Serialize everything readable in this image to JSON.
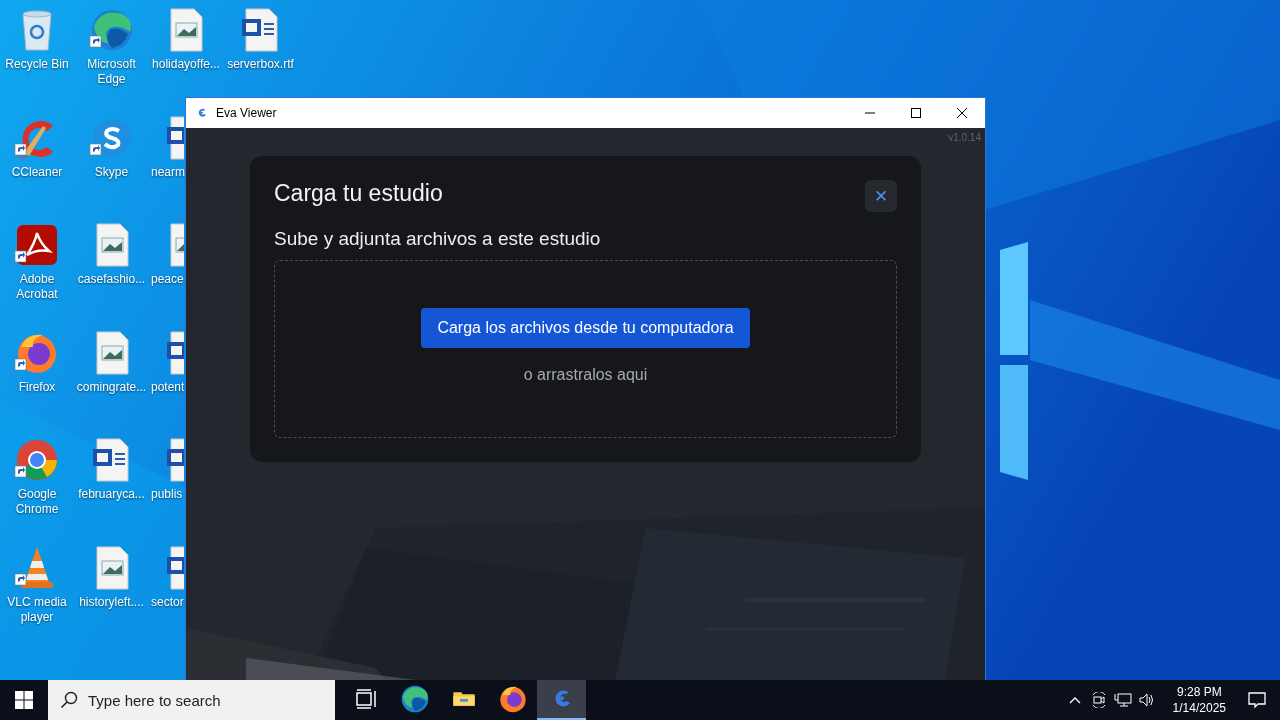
{
  "desktop": {
    "columns": [
      [
        {
          "label": "Recycle Bin",
          "kind": "recycle-bin",
          "shortcut": false
        },
        {
          "label": "CCleaner",
          "kind": "ccleaner",
          "shortcut": true
        },
        {
          "label": "Adobe Acrobat",
          "kind": "acrobat",
          "shortcut": true
        },
        {
          "label": "Firefox",
          "kind": "firefox",
          "shortcut": true
        },
        {
          "label": "Google Chrome",
          "kind": "chrome",
          "shortcut": true
        },
        {
          "label": "VLC media player",
          "kind": "vlc",
          "shortcut": true
        }
      ],
      [
        {
          "label": "Microsoft Edge",
          "kind": "edge",
          "shortcut": true
        },
        {
          "label": "Skype",
          "kind": "skype",
          "shortcut": true
        },
        {
          "label": "casefashio...",
          "kind": "image-file",
          "shortcut": false
        },
        {
          "label": "comingrate...",
          "kind": "image-file",
          "shortcut": false
        },
        {
          "label": "februaryca...",
          "kind": "word-file",
          "shortcut": false
        },
        {
          "label": "historyleft....",
          "kind": "image-file",
          "shortcut": false
        }
      ],
      [
        {
          "label": "holidayoffe...",
          "kind": "image-file",
          "shortcut": false
        },
        {
          "label": "nearm",
          "kind": "word-file",
          "shortcut": false
        },
        {
          "label": "peace",
          "kind": "image-file",
          "shortcut": false
        },
        {
          "label": "potent",
          "kind": "word-file",
          "shortcut": false
        },
        {
          "label": "publis",
          "kind": "word-file",
          "shortcut": false
        },
        {
          "label": "sector",
          "kind": "word-file",
          "shortcut": false
        }
      ],
      [
        {
          "label": "serverbox.rtf",
          "kind": "word-file",
          "shortcut": false
        }
      ]
    ]
  },
  "window": {
    "title": "Eva Viewer",
    "version": "v1.0.14",
    "dialog": {
      "title": "Carga tu estudio",
      "close": "✕",
      "subtitle": "Sube y adjunta archivos a este estudio",
      "upload_button": "Carga los archivos desde tu computadora",
      "drop_hint": "o arrastralos aqui"
    }
  },
  "taskbar": {
    "search": {
      "placeholder": "Type here to search"
    },
    "apps": [
      {
        "kind": "task-view",
        "selected": false
      },
      {
        "kind": "edge",
        "selected": false
      },
      {
        "kind": "folder",
        "selected": false
      },
      {
        "kind": "firefox",
        "selected": false
      },
      {
        "kind": "eva",
        "selected": true
      }
    ],
    "time": "9:28 PM",
    "date": "1/14/2025"
  }
}
